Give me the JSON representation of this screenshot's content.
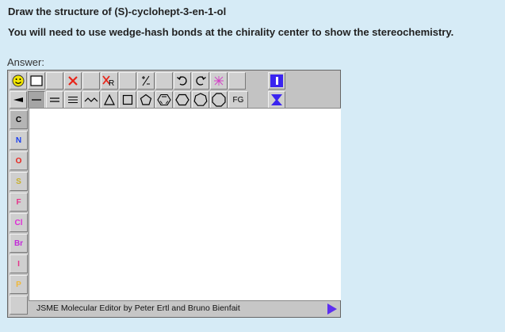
{
  "question": {
    "title": "Draw the structure of (S)-cyclohept-3-en-1-ol",
    "instruction": "You will need to use wedge-hash bonds at the chirality center to show the stereochemistry."
  },
  "answer_label": "Answer:",
  "editor": {
    "toolbar_top": [
      {
        "name": "smiley-icon",
        "label": ""
      },
      {
        "name": "rectangle-select-icon",
        "label": ""
      },
      {
        "name": "blank-button-1",
        "label": ""
      },
      {
        "name": "delete-x-icon",
        "label": ""
      },
      {
        "name": "blank-button-2",
        "label": ""
      },
      {
        "name": "delete-r-group-icon",
        "label": "R"
      },
      {
        "name": "blank-button-3",
        "label": ""
      },
      {
        "name": "charge-plus-minus-icon",
        "label": "+/-"
      },
      {
        "name": "blank-button-4",
        "label": ""
      },
      {
        "name": "undo-icon",
        "label": ""
      },
      {
        "name": "redo-icon",
        "label": ""
      },
      {
        "name": "clear-x-icon",
        "label": ""
      },
      {
        "name": "blank-button-5",
        "label": ""
      },
      {
        "name": "jsme-logo-icon",
        "label": ""
      }
    ],
    "toolbar_bonds": [
      {
        "name": "wedge-bond-icon"
      },
      {
        "name": "single-bond-icon"
      },
      {
        "name": "double-bond-icon"
      },
      {
        "name": "triple-bond-icon"
      },
      {
        "name": "chain-icon"
      },
      {
        "name": "ring-3-icon"
      },
      {
        "name": "ring-4-icon"
      },
      {
        "name": "ring-5-icon"
      },
      {
        "name": "benzene-icon"
      },
      {
        "name": "ring-6-icon"
      },
      {
        "name": "ring-7-icon"
      },
      {
        "name": "ring-8-icon"
      },
      {
        "name": "functional-group-button",
        "label": "FG"
      },
      {
        "name": "jsme-triangle-icon"
      }
    ],
    "atoms": [
      {
        "symbol": "C",
        "color": "#000000"
      },
      {
        "symbol": "N",
        "color": "#1a3ff0"
      },
      {
        "symbol": "O",
        "color": "#e8241c"
      },
      {
        "symbol": "S",
        "color": "#c9b02a"
      },
      {
        "symbol": "F",
        "color": "#e6308a"
      },
      {
        "symbol": "Cl",
        "color": "#e02ad6"
      },
      {
        "symbol": "Br",
        "color": "#c32ad9"
      },
      {
        "symbol": "I",
        "color": "#e6308a"
      },
      {
        "symbol": "P",
        "color": "#f0b838"
      },
      {
        "symbol": "",
        "color": "#000000"
      }
    ],
    "status_text": "JSME Molecular Editor by Peter Ertl and Bruno Bienfait",
    "accent_color": "#5d2ff0"
  }
}
